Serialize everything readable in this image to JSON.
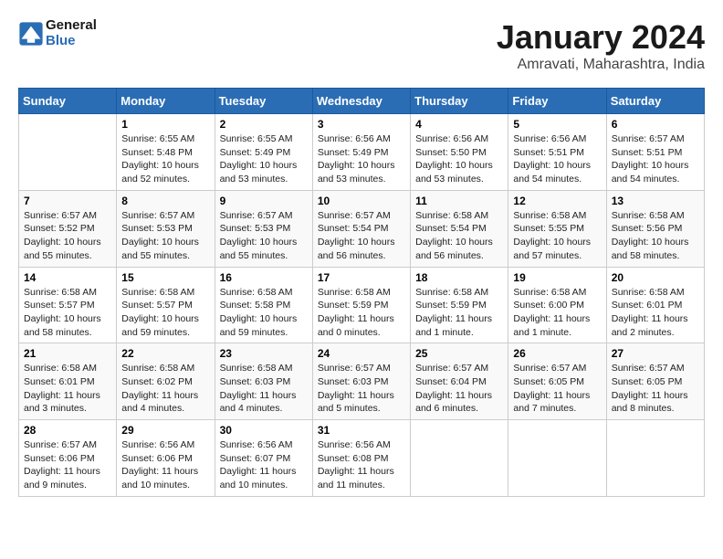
{
  "logo": {
    "name_part1": "General",
    "name_part2": "Blue"
  },
  "title": "January 2024",
  "subtitle": "Amravati, Maharashtra, India",
  "headers": [
    "Sunday",
    "Monday",
    "Tuesday",
    "Wednesday",
    "Thursday",
    "Friday",
    "Saturday"
  ],
  "weeks": [
    [
      {
        "day": "",
        "info": ""
      },
      {
        "day": "1",
        "info": "Sunrise: 6:55 AM\nSunset: 5:48 PM\nDaylight: 10 hours\nand 52 minutes."
      },
      {
        "day": "2",
        "info": "Sunrise: 6:55 AM\nSunset: 5:49 PM\nDaylight: 10 hours\nand 53 minutes."
      },
      {
        "day": "3",
        "info": "Sunrise: 6:56 AM\nSunset: 5:49 PM\nDaylight: 10 hours\nand 53 minutes."
      },
      {
        "day": "4",
        "info": "Sunrise: 6:56 AM\nSunset: 5:50 PM\nDaylight: 10 hours\nand 53 minutes."
      },
      {
        "day": "5",
        "info": "Sunrise: 6:56 AM\nSunset: 5:51 PM\nDaylight: 10 hours\nand 54 minutes."
      },
      {
        "day": "6",
        "info": "Sunrise: 6:57 AM\nSunset: 5:51 PM\nDaylight: 10 hours\nand 54 minutes."
      }
    ],
    [
      {
        "day": "7",
        "info": "Sunrise: 6:57 AM\nSunset: 5:52 PM\nDaylight: 10 hours\nand 55 minutes."
      },
      {
        "day": "8",
        "info": "Sunrise: 6:57 AM\nSunset: 5:53 PM\nDaylight: 10 hours\nand 55 minutes."
      },
      {
        "day": "9",
        "info": "Sunrise: 6:57 AM\nSunset: 5:53 PM\nDaylight: 10 hours\nand 55 minutes."
      },
      {
        "day": "10",
        "info": "Sunrise: 6:57 AM\nSunset: 5:54 PM\nDaylight: 10 hours\nand 56 minutes."
      },
      {
        "day": "11",
        "info": "Sunrise: 6:58 AM\nSunset: 5:54 PM\nDaylight: 10 hours\nand 56 minutes."
      },
      {
        "day": "12",
        "info": "Sunrise: 6:58 AM\nSunset: 5:55 PM\nDaylight: 10 hours\nand 57 minutes."
      },
      {
        "day": "13",
        "info": "Sunrise: 6:58 AM\nSunset: 5:56 PM\nDaylight: 10 hours\nand 58 minutes."
      }
    ],
    [
      {
        "day": "14",
        "info": "Sunrise: 6:58 AM\nSunset: 5:57 PM\nDaylight: 10 hours\nand 58 minutes."
      },
      {
        "day": "15",
        "info": "Sunrise: 6:58 AM\nSunset: 5:57 PM\nDaylight: 10 hours\nand 59 minutes."
      },
      {
        "day": "16",
        "info": "Sunrise: 6:58 AM\nSunset: 5:58 PM\nDaylight: 10 hours\nand 59 minutes."
      },
      {
        "day": "17",
        "info": "Sunrise: 6:58 AM\nSunset: 5:59 PM\nDaylight: 11 hours\nand 0 minutes."
      },
      {
        "day": "18",
        "info": "Sunrise: 6:58 AM\nSunset: 5:59 PM\nDaylight: 11 hours\nand 1 minute."
      },
      {
        "day": "19",
        "info": "Sunrise: 6:58 AM\nSunset: 6:00 PM\nDaylight: 11 hours\nand 1 minute."
      },
      {
        "day": "20",
        "info": "Sunrise: 6:58 AM\nSunset: 6:01 PM\nDaylight: 11 hours\nand 2 minutes."
      }
    ],
    [
      {
        "day": "21",
        "info": "Sunrise: 6:58 AM\nSunset: 6:01 PM\nDaylight: 11 hours\nand 3 minutes."
      },
      {
        "day": "22",
        "info": "Sunrise: 6:58 AM\nSunset: 6:02 PM\nDaylight: 11 hours\nand 4 minutes."
      },
      {
        "day": "23",
        "info": "Sunrise: 6:58 AM\nSunset: 6:03 PM\nDaylight: 11 hours\nand 4 minutes."
      },
      {
        "day": "24",
        "info": "Sunrise: 6:57 AM\nSunset: 6:03 PM\nDaylight: 11 hours\nand 5 minutes."
      },
      {
        "day": "25",
        "info": "Sunrise: 6:57 AM\nSunset: 6:04 PM\nDaylight: 11 hours\nand 6 minutes."
      },
      {
        "day": "26",
        "info": "Sunrise: 6:57 AM\nSunset: 6:05 PM\nDaylight: 11 hours\nand 7 minutes."
      },
      {
        "day": "27",
        "info": "Sunrise: 6:57 AM\nSunset: 6:05 PM\nDaylight: 11 hours\nand 8 minutes."
      }
    ],
    [
      {
        "day": "28",
        "info": "Sunrise: 6:57 AM\nSunset: 6:06 PM\nDaylight: 11 hours\nand 9 minutes."
      },
      {
        "day": "29",
        "info": "Sunrise: 6:56 AM\nSunset: 6:06 PM\nDaylight: 11 hours\nand 10 minutes."
      },
      {
        "day": "30",
        "info": "Sunrise: 6:56 AM\nSunset: 6:07 PM\nDaylight: 11 hours\nand 10 minutes."
      },
      {
        "day": "31",
        "info": "Sunrise: 6:56 AM\nSunset: 6:08 PM\nDaylight: 11 hours\nand 11 minutes."
      },
      {
        "day": "",
        "info": ""
      },
      {
        "day": "",
        "info": ""
      },
      {
        "day": "",
        "info": ""
      }
    ]
  ]
}
